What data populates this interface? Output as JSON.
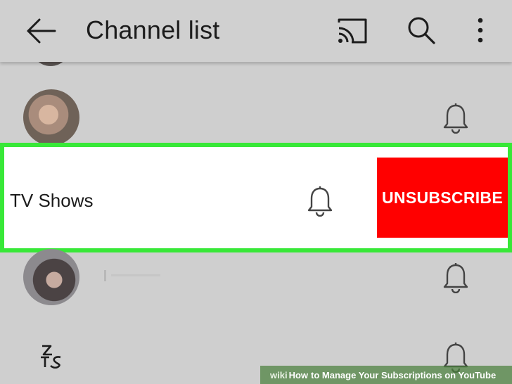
{
  "appbar": {
    "title": "Channel list",
    "icons": {
      "back": "arrow-left-icon",
      "cast": "cast-icon",
      "search": "search-icon",
      "more": "more-vertical-icon"
    }
  },
  "rows": [
    {
      "bell": "bell-icon"
    },
    {
      "name": "TV Shows",
      "bell": "bell-icon",
      "action": "UNSUBSCRIBE"
    },
    {
      "bell": "bell-icon"
    },
    {
      "bell": "bell-icon"
    }
  ],
  "colors": {
    "unsubscribe": "#ff0000",
    "highlight": "#38e838",
    "background": "#cfcfcf"
  },
  "banner": {
    "site": "wiki",
    "how": "How",
    "text": "to Manage Your Subscriptions on YouTube"
  }
}
